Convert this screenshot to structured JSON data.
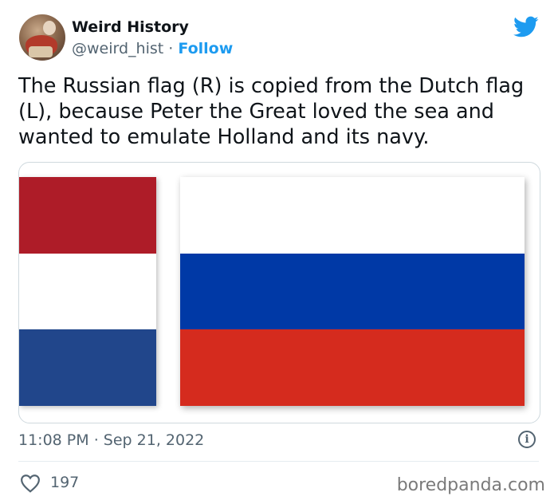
{
  "account": {
    "name": "Weird History",
    "handle": "@weird_hist",
    "separator": "·",
    "follow_label": "Follow"
  },
  "tweet": {
    "text": "The Russian flag (R) is copied from the Dutch flag (L), because Peter the Great loved the sea and wanted to emulate Holland and its navy.",
    "time": "11:08 PM",
    "date_separator": "·",
    "date": "Sep 21, 2022",
    "likes": "197"
  },
  "media": {
    "dutch_flag_colors": [
      "#ae1c28",
      "#ffffff",
      "#21468b"
    ],
    "russian_flag_colors": [
      "#ffffff",
      "#0039a6",
      "#d52b1e"
    ]
  },
  "icons": {
    "brand": "twitter-bird-icon",
    "info": "info-icon",
    "like": "heart-icon"
  },
  "colors": {
    "accent": "#1d9bf0",
    "secondary_text": "#536471"
  },
  "watermark": "boredpanda.com"
}
